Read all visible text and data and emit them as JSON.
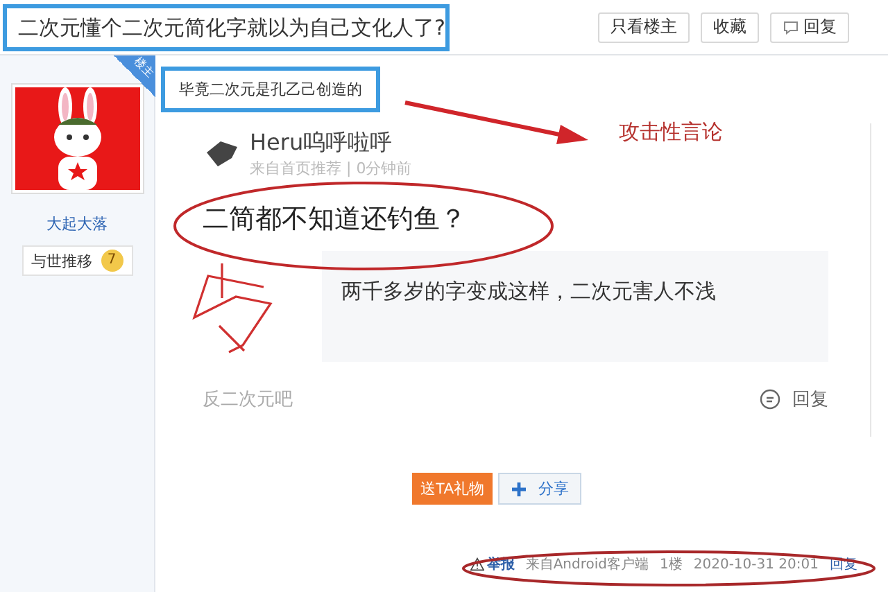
{
  "thread": {
    "title": "二次元懂个二次元简化字就以为自己文化人了?",
    "buttons": [
      {
        "label": "只看楼主",
        "icon": false
      },
      {
        "label": "收藏",
        "icon": false
      },
      {
        "label": "回复",
        "icon": true
      }
    ]
  },
  "author": {
    "badge": "楼主",
    "name": "大起大落",
    "title": "与世推移",
    "level": "7"
  },
  "post": {
    "text": "毕竟二次元是孔乙己创造的",
    "embed": {
      "user": "Heru呜呼啦呼",
      "meta": "来自首页推荐 | 0分钟前",
      "headline": "二简都不知道还钓鱼？",
      "quote": "两千多岁的字变成这样，二次元害人不浅",
      "forum": "反二次元吧",
      "reply": "回复"
    },
    "gift_button": "送TA礼物",
    "share_button": "分享",
    "footer": {
      "report": "举报",
      "source": "来自Android客户端",
      "floor": "1楼",
      "time": "2020-10-31 20:01",
      "reply": "回复"
    }
  },
  "annotation": {
    "label": "攻击性言论"
  }
}
